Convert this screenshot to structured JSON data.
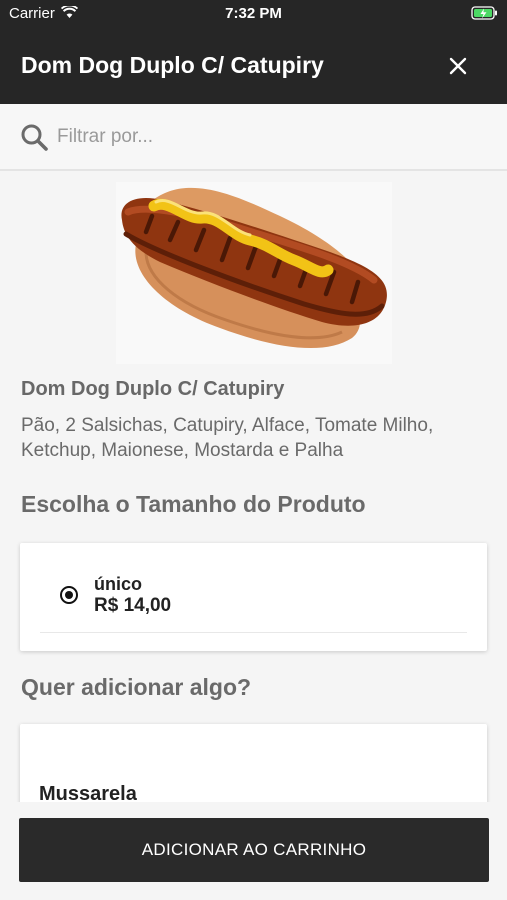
{
  "status_bar": {
    "carrier": "Carrier",
    "time": "7:32 PM"
  },
  "header": {
    "title": "Dom Dog Duplo C/ Catupiry",
    "close_icon": "close-icon"
  },
  "search": {
    "placeholder": "Filtrar por...",
    "value": ""
  },
  "product": {
    "image": "hotdog-image",
    "name": "Dom Dog Duplo C/ Catupiry",
    "description": "Pão, 2 Salsichas, Catupiry, Alface, Tomate Milho, Ketchup, Maionese, Mostarda e Palha"
  },
  "size_section": {
    "title": "Escolha o Tamanho do Produto",
    "options": [
      {
        "name": "único",
        "price": "R$ 14,00",
        "selected": true
      }
    ]
  },
  "addons_section": {
    "title": "Quer adicionar algo?",
    "items": [
      {
        "name": "Mussarela"
      }
    ]
  },
  "footer": {
    "add_to_cart_label": "ADICIONAR AO CARRINHO"
  },
  "colors": {
    "header_bg": "#262626",
    "button_bg": "#2a2a2a",
    "mustard": "#f2c316",
    "sausage": "#8f3510"
  }
}
